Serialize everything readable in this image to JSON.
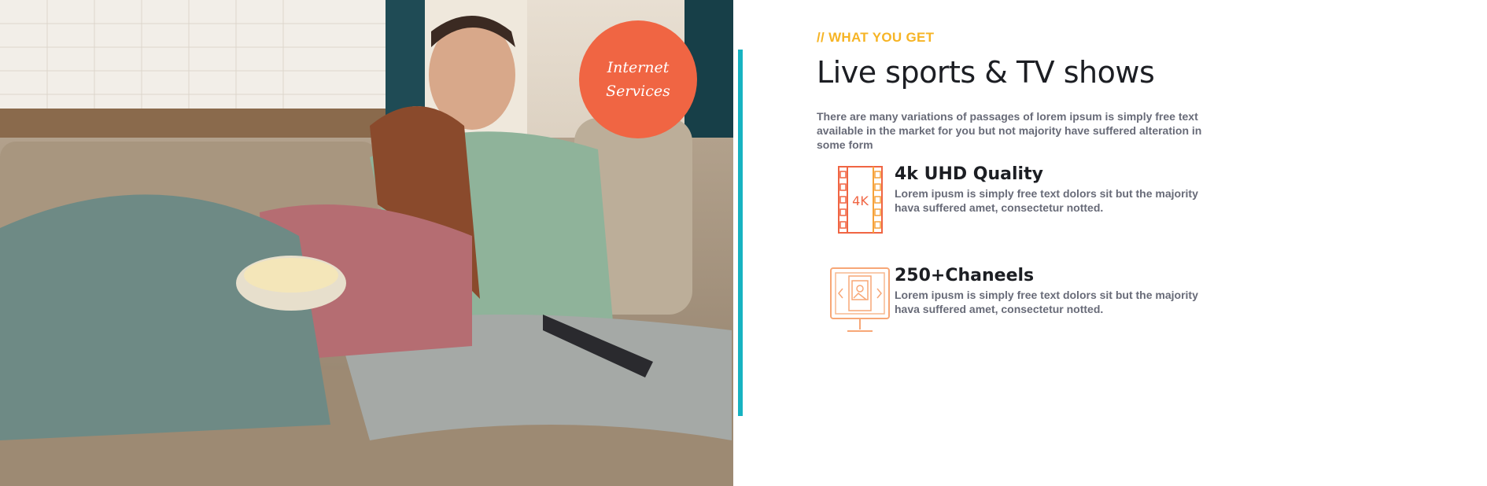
{
  "photo": {
    "alt": "Couple relaxing on a sofa with popcorn and a TV remote",
    "badge_line1": "Internet",
    "badge_line2": "Services"
  },
  "section": {
    "eyebrow": "// WHAT YOU GET",
    "title": "Live sports & TV shows",
    "intro": "There are many variations of passages of lorem ipsum is simply free text available in the market for you but not majority have suffered alteration in some form"
  },
  "features": [
    {
      "icon": "4k-film-icon",
      "title": "4k UHD Quality",
      "text": "Lorem ipusm is simply free text dolors sit but the majority hava suffered amet, consectetur notted."
    },
    {
      "icon": "tv-monitor-icon",
      "title": "250+Chaneels",
      "text": "Lorem ipusm is simply free text dolors sit but the majority hava suffered amet, consectetur notted."
    }
  ],
  "colors": {
    "accent_orange": "#f06543",
    "eyebrow_yellow": "#f6b425",
    "divider_teal": "#17b3c1",
    "heading": "#1c1e23",
    "body_text": "#686b78"
  }
}
